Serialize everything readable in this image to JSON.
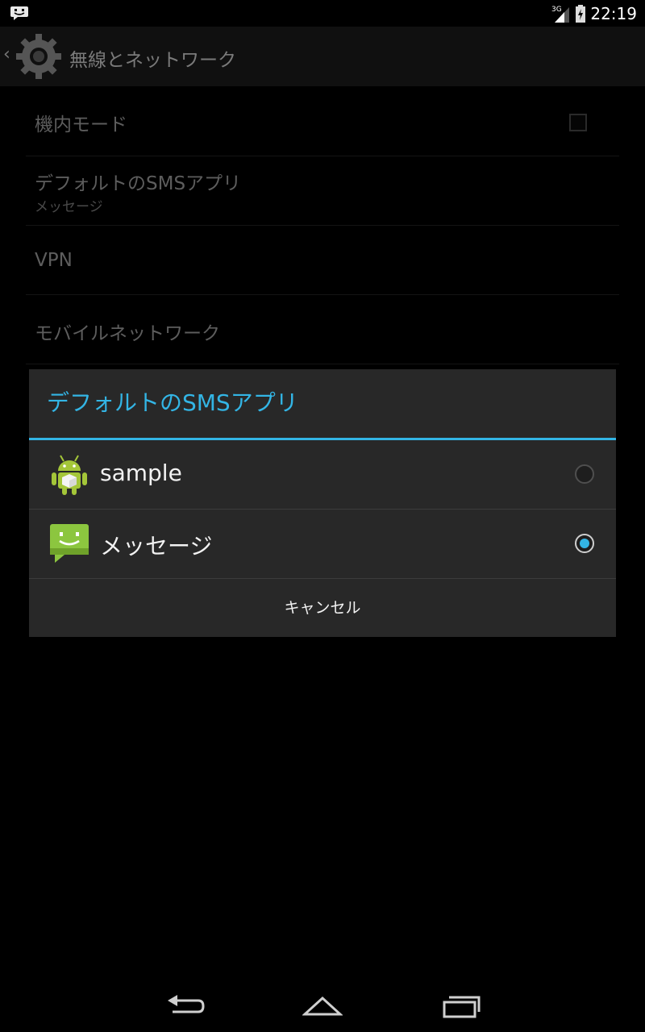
{
  "status_bar": {
    "notification_icon": "message-notification-icon",
    "network_label": "3G",
    "time": "22:19"
  },
  "action_bar": {
    "up_icon": "chevron-left-icon",
    "app_icon": "settings-gear-icon",
    "title": "無線とネットワーク"
  },
  "settings": {
    "items": [
      {
        "title": "機内モード",
        "checked": false
      },
      {
        "title": "デフォルトのSMSアプリ",
        "subtitle": "メッセージ"
      },
      {
        "title": "VPN"
      },
      {
        "title": "モバイルネットワーク"
      }
    ]
  },
  "dialog": {
    "title": "デフォルトのSMSアプリ",
    "options": [
      {
        "label": "sample",
        "icon": "android-robot-icon",
        "selected": false
      },
      {
        "label": "メッセージ",
        "icon": "messaging-app-icon",
        "selected": true
      }
    ],
    "cancel_label": "キャンセル"
  },
  "colors": {
    "accent": "#33b5e5",
    "dialog_background": "#282828"
  },
  "nav_bar": {
    "back_icon": "back-icon",
    "home_icon": "home-icon",
    "recents_icon": "recents-icon"
  }
}
